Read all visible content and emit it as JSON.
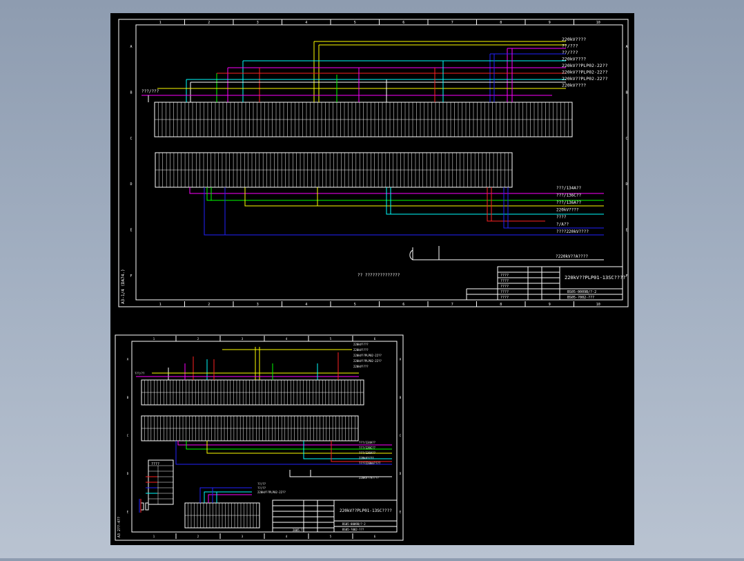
{
  "colors": {
    "background_top": "#8e9cb0",
    "canvas": "#000000",
    "frame": "#ffffff",
    "wire_yellow": "#ffff00",
    "wire_cyan": "#00ffff",
    "wire_magenta": "#ff00ff",
    "wire_blue": "#2020ff",
    "wire_red": "#ff2020",
    "wire_green": "#00ff00"
  },
  "sheet1": {
    "grid_columns": [
      "1",
      "2",
      "3",
      "4",
      "5",
      "6",
      "7",
      "8",
      "9",
      "10"
    ],
    "grid_rows": [
      "A",
      "B",
      "C",
      "D",
      "E",
      "F"
    ],
    "side_label": "A3-1/4 (DA74.)",
    "left_bus_label": "???/???",
    "top_right_labels": [
      "220kV????",
      "??/???",
      "??/???",
      "220kV????",
      "220kV??PLP02-22??",
      "220kV??PLP02-22??",
      "220kV??PLP02-22??",
      "220kV????"
    ],
    "right_mid_labels": [
      "???/134A??",
      "???/136C??",
      "???/136A??",
      "220kV????",
      "????",
      "?/A??",
      "????220kV????"
    ],
    "bottom_right_label": "?220kV??A????",
    "note": "??  ??????????????",
    "title_block": {
      "title": "220kV??PLP01-13SC????",
      "drawing_no": "BS05-0009B/?-2",
      "sub_no": "BS05-?002-???",
      "rows": [
        "????",
        "????",
        "????",
        "????",
        "????"
      ]
    }
  },
  "sheet2": {
    "grid_columns": [
      "1",
      "2",
      "3",
      "4",
      "5",
      "6"
    ],
    "grid_rows": [
      "A",
      "B",
      "C",
      "D",
      "E"
    ],
    "side_label": "A3 2??-4??",
    "left_bus_label": "???/??",
    "top_right_labels": [
      "220kV????",
      "220kV????",
      "220kV??PLP02-22??",
      "220kV??PLP02-22??",
      "220kV????"
    ],
    "right_mid_labels": [
      "???/134A??",
      "???/136C??",
      "???/136A??",
      "220kV????",
      "????220kV????"
    ],
    "mid_labels": [
      "??/??",
      "??/??",
      "220kV??PLP02-22??"
    ],
    "right_bottom_label": "220kV??A????",
    "legend_title": "????",
    "title_block": {
      "title": "220kV??PLP01-13SC????",
      "drawing_no": "BS05-0009B/?-2",
      "sub_no": "BS05-?002-???",
      "date": "2005.??"
    }
  }
}
